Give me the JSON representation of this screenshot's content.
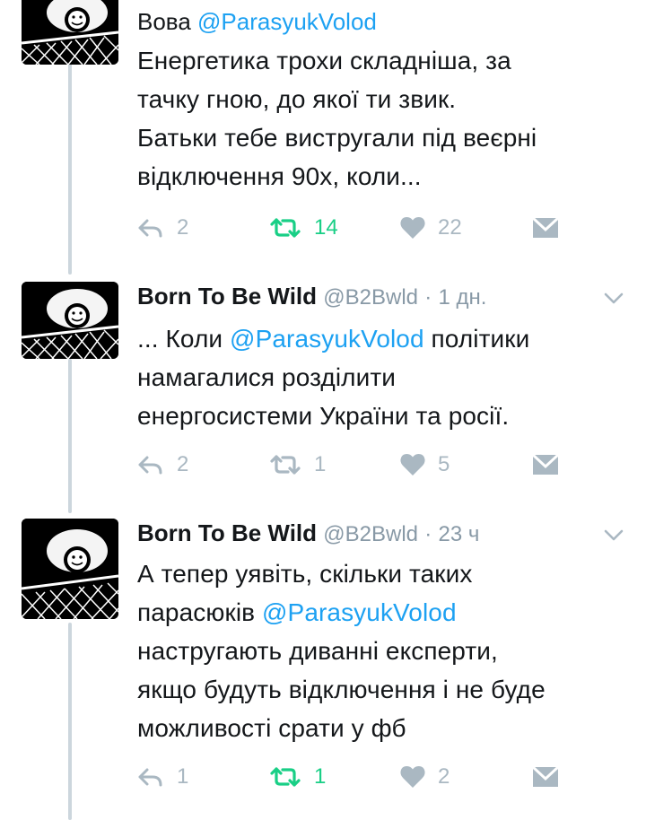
{
  "tweets": [
    {
      "name": "Вова",
      "handle": "@ParasyukVolod",
      "handle_sep": "",
      "time": "",
      "text_pre": "",
      "mention": "",
      "text_lines": [
        "Енергетика трохи складніша, за",
        "тачку гною, до якої ти звик.",
        "Батьки тебе вистругали під веєрні",
        "відключення 90х, коли..."
      ],
      "replies": "2",
      "retweets": "14",
      "retweeted": true,
      "likes": "22"
    },
    {
      "name": "Born To Be Wild",
      "handle": "@B2Bwld",
      "handle_sep": "·",
      "time": "1 дн.",
      "line1_pre": "... Коли ",
      "line1_mention": "@ParasyukVolod",
      "line1_post": " політики",
      "line2": "намагалися розділити",
      "line3": "енергосистеми України та росії.",
      "replies": "2",
      "retweets": "1",
      "retweeted": false,
      "likes": "5"
    },
    {
      "name": "Born To Be Wild",
      "handle": "@B2Bwld",
      "handle_sep": "·",
      "time": "23 ч",
      "line1": "А тепер уявіть, скільки таких",
      "line2_pre": "парасюків ",
      "line2_mention": "@ParasyukVolod",
      "line3": "настругають диванні експерти,",
      "line4": "якщо будуть відключення і не буде",
      "line5": "можливості срати у фб",
      "replies": "1",
      "retweets": "1",
      "retweeted": true,
      "likes": "2"
    }
  ],
  "colors": {
    "link": "#1da1f2",
    "retweet_active": "#19cf86",
    "icon_gray": "#aab8c2",
    "meta_gray": "#8899a6",
    "thread_line": "#ccd6dd"
  },
  "icons": [
    "reply-icon",
    "retweet-icon",
    "heart-icon",
    "direct-message-icon",
    "chevron-down-icon"
  ]
}
